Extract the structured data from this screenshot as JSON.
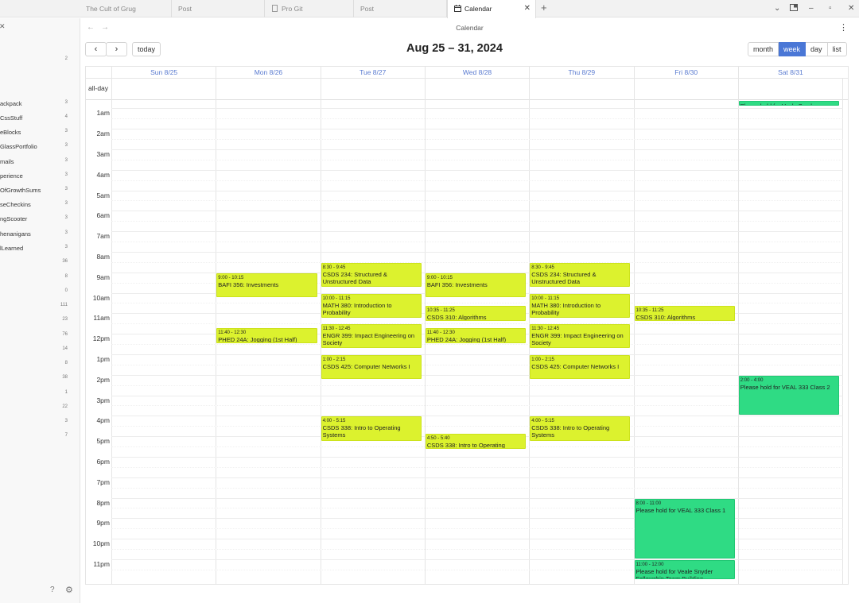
{
  "tabs": [
    {
      "label": "The Cult of Grug",
      "active": false
    },
    {
      "label": "Post",
      "active": false
    },
    {
      "label": "Pro Git",
      "active": false
    },
    {
      "label": "Post",
      "active": false
    },
    {
      "label": "Calendar",
      "active": true
    }
  ],
  "window": {
    "title": "Calendar"
  },
  "sidebar": {
    "items": [
      {
        "label": "",
        "count": "2"
      },
      {
        "label": "ackpack",
        "count": "3"
      },
      {
        "label": "CssStuff",
        "count": "4"
      },
      {
        "label": "eBlocks",
        "count": "3"
      },
      {
        "label": "GlassPortfolio",
        "count": "3"
      },
      {
        "label": "mails",
        "count": "3"
      },
      {
        "label": "perience",
        "count": "3"
      },
      {
        "label": "OfGrowthSums",
        "count": "3"
      },
      {
        "label": "seCheckins",
        "count": "3"
      },
      {
        "label": "ngScooter",
        "count": "3"
      },
      {
        "label": "henanigans",
        "count": "3"
      },
      {
        "label": "lLearned",
        "count": "3"
      },
      {
        "label": "",
        "count": "36"
      },
      {
        "label": "",
        "count": "8"
      },
      {
        "label": "",
        "count": "0"
      },
      {
        "label": "",
        "count": "111"
      },
      {
        "label": "",
        "count": "23"
      },
      {
        "label": "",
        "count": "76"
      },
      {
        "label": "",
        "count": "14"
      },
      {
        "label": "",
        "count": "8"
      },
      {
        "label": "",
        "count": "38"
      },
      {
        "label": "",
        "count": "1"
      },
      {
        "label": "",
        "count": "22"
      },
      {
        "label": "",
        "count": "3"
      },
      {
        "label": "",
        "count": "7"
      }
    ]
  },
  "toolbar": {
    "today": "today",
    "prev": "‹",
    "next": "›"
  },
  "calendar": {
    "title": "Aug 25 – 31, 2024",
    "views": [
      {
        "label": "month",
        "active": false
      },
      {
        "label": "week",
        "active": true
      },
      {
        "label": "day",
        "active": false
      },
      {
        "label": "list",
        "active": false
      }
    ],
    "allday_label": "all-day",
    "days": [
      "Sun 8/25",
      "Mon 8/26",
      "Tue 8/27",
      "Wed 8/28",
      "Thu 8/29",
      "Fri 8/30",
      "Sat 8/31"
    ],
    "hours": [
      "1am",
      "2am",
      "3am",
      "4am",
      "5am",
      "6am",
      "7am",
      "8am",
      "9am",
      "10am",
      "11am",
      "12pm",
      "1pm",
      "2pm",
      "3pm",
      "4pm",
      "5pm",
      "6pm",
      "7pm",
      "8pm",
      "9pm",
      "10pm",
      "11pm"
    ],
    "events": [
      {
        "day": 1,
        "start": 9.0,
        "end": 10.25,
        "time": "9:00 - 10:15",
        "title": "BAFI 356: Investments",
        "color": "yellow"
      },
      {
        "day": 1,
        "start": 11.667,
        "end": 12.5,
        "time": "11:40 - 12:30",
        "title": "PHED 24A: Jogging (1st Half)",
        "color": "yellow"
      },
      {
        "day": 2,
        "start": 8.5,
        "end": 9.75,
        "time": "8:30 - 9:45",
        "title": "CSDS 234: Structured & Unstructured Data",
        "color": "yellow"
      },
      {
        "day": 2,
        "start": 10.0,
        "end": 11.25,
        "time": "10:00 - 11:15",
        "title": "MATH 380: Introduction to Probability",
        "color": "yellow"
      },
      {
        "day": 2,
        "start": 11.5,
        "end": 12.75,
        "time": "11:30 - 12:45",
        "title": "ENGR 399: Impact Engineering on Society",
        "color": "yellow"
      },
      {
        "day": 2,
        "start": 13.0,
        "end": 14.25,
        "time": "1:00 - 2:15",
        "title": "CSDS 425: Computer Networks I",
        "color": "yellow"
      },
      {
        "day": 2,
        "start": 16.0,
        "end": 17.25,
        "time": "4:00 - 5:15",
        "title": "CSDS 338: Intro to Operating Systems",
        "color": "yellow"
      },
      {
        "day": 3,
        "start": 9.0,
        "end": 10.25,
        "time": "9:00 - 10:15",
        "title": "BAFI 356: Investments",
        "color": "yellow"
      },
      {
        "day": 3,
        "start": 10.583,
        "end": 11.417,
        "time": "10:35 - 11:25",
        "title": "CSDS 310: Algorithms",
        "color": "yellow"
      },
      {
        "day": 3,
        "start": 11.667,
        "end": 12.5,
        "time": "11:40 - 12:30",
        "title": "PHED 24A: Jogging (1st Half)",
        "color": "yellow"
      },
      {
        "day": 3,
        "start": 16.833,
        "end": 17.667,
        "time": "4:50 - 5:40",
        "title": "CSDS 338: Intro to Operating",
        "color": "yellow"
      },
      {
        "day": 4,
        "start": 8.5,
        "end": 9.75,
        "time": "8:30 - 9:45",
        "title": "CSDS 234: Structured & Unstructured Data",
        "color": "yellow"
      },
      {
        "day": 4,
        "start": 10.0,
        "end": 11.25,
        "time": "10:00 - 11:15",
        "title": "MATH 380: Introduction to Probability",
        "color": "yellow"
      },
      {
        "day": 4,
        "start": 11.5,
        "end": 12.75,
        "time": "11:30 - 12:45",
        "title": "ENGR 399: Impact Engineering on Society",
        "color": "yellow"
      },
      {
        "day": 4,
        "start": 13.0,
        "end": 14.25,
        "time": "1:00 - 2:15",
        "title": "CSDS 425: Computer Networks I",
        "color": "yellow"
      },
      {
        "day": 4,
        "start": 16.0,
        "end": 17.25,
        "time": "4:00 - 5:15",
        "title": "CSDS 338: Intro to Operating Systems",
        "color": "yellow"
      },
      {
        "day": 5,
        "start": 10.583,
        "end": 11.417,
        "time": "10:35 - 11:25",
        "title": "CSDS 310: Algorithms",
        "color": "yellow"
      },
      {
        "day": 5,
        "start": 20.0,
        "end": 23.0,
        "time": "8:00 - 11:00",
        "title": "Please hold for VEAL 333 Class 1",
        "color": "green"
      },
      {
        "day": 5,
        "start": 23.0,
        "end": 24.0,
        "time": "11:00 - 12:00",
        "title": "Please hold for Veale Snyder Fellowship Team Building",
        "color": "green"
      },
      {
        "day": 6,
        "start": 0.0,
        "end": 0.667,
        "time": "",
        "title": "Please hold for Veale Snyder Fellowship Team Building",
        "color": "green"
      },
      {
        "day": 6,
        "start": 14.0,
        "end": 16.0,
        "time": "2:00 - 4:00",
        "title": "Please hold for VEAL 333 Class 2",
        "color": "green"
      }
    ]
  }
}
